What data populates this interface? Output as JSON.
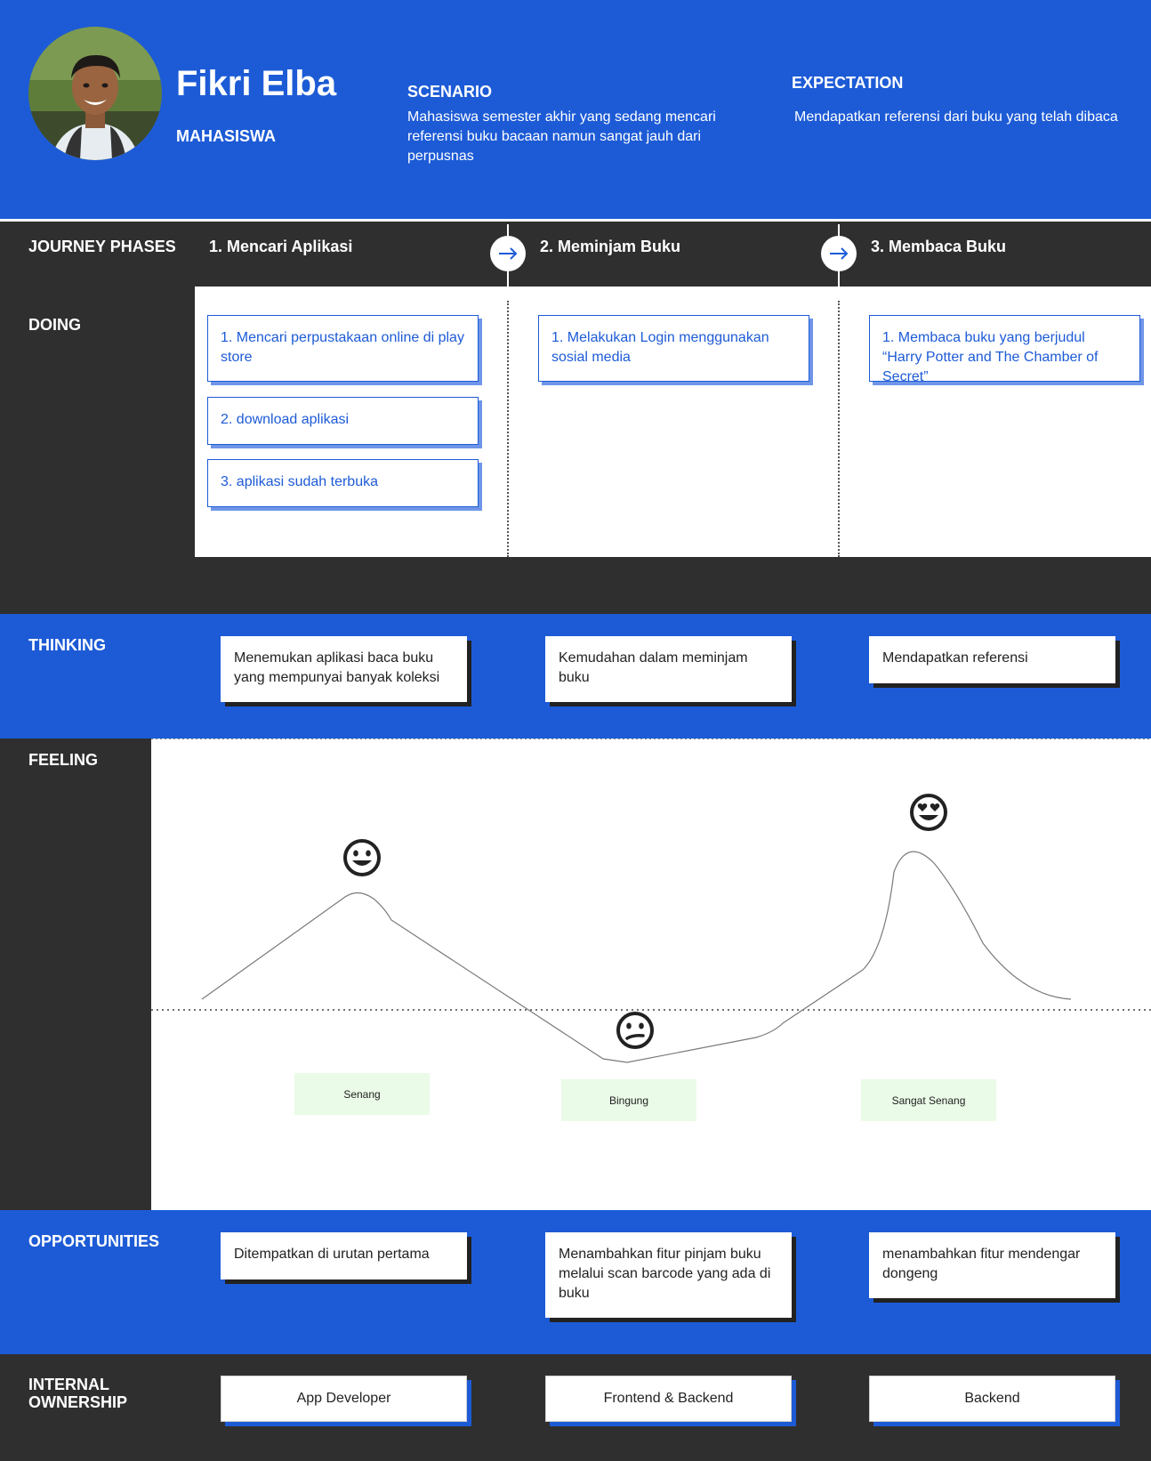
{
  "persona": {
    "name": "Fikri Elba",
    "role": "MAHASISWA",
    "scenario_title": "SCENARIO",
    "scenario_text": "Mahasiswa semester akhir yang sedang mencari referensi buku bacaan namun sangat jauh dari perpusnas",
    "expectation_title": "EXPECTATION",
    "expectation_text": "Mendapatkan referensi dari buku yang telah dibaca"
  },
  "rows": {
    "phases": "JOURNEY PHASES",
    "doing": "DOING",
    "thinking": "THINKING",
    "feeling": "FEELING",
    "opportunities": "OPPORTUNITIES",
    "ownership_line1": "INTERNAL",
    "ownership_line2": "OWNERSHIP"
  },
  "phases": [
    "1. Mencari Aplikasi",
    "2. Meminjam Buku",
    "3. Membaca Buku"
  ],
  "doing": {
    "phase1": [
      "1. Mencari perpustakaan online di play store",
      "2. download aplikasi",
      "3. aplikasi sudah terbuka"
    ],
    "phase2": [
      "1.  Melakukan Login menggunakan sosial media"
    ],
    "phase3": [
      "1. Membaca buku yang berjudul “Harry Potter and The Chamber of Secret”"
    ]
  },
  "thinking": [
    "Menemukan aplikasi baca buku yang mempunyai banyak koleksi",
    "Kemudahan dalam meminjam buku",
    "Mendapatkan referensi"
  ],
  "feeling": [
    {
      "label": "Senang",
      "icon": "smile-icon"
    },
    {
      "label": "Bingung",
      "icon": "confused-icon"
    },
    {
      "label": "Sangat Senang",
      "icon": "heart-eyes-icon"
    }
  ],
  "opportunities": [
    "Ditempatkan di urutan pertama",
    "Menambahkan fitur pinjam buku melalui scan barcode yang ada di buku",
    "menambahkan fitur mendengar dongeng"
  ],
  "ownership": [
    "App Developer",
    "Frontend & Backend",
    "Backend"
  ],
  "colors": {
    "brand_blue": "#1d5bd6",
    "dark": "#2f2f2f",
    "emotion_tag_bg": "#eafbe7"
  }
}
